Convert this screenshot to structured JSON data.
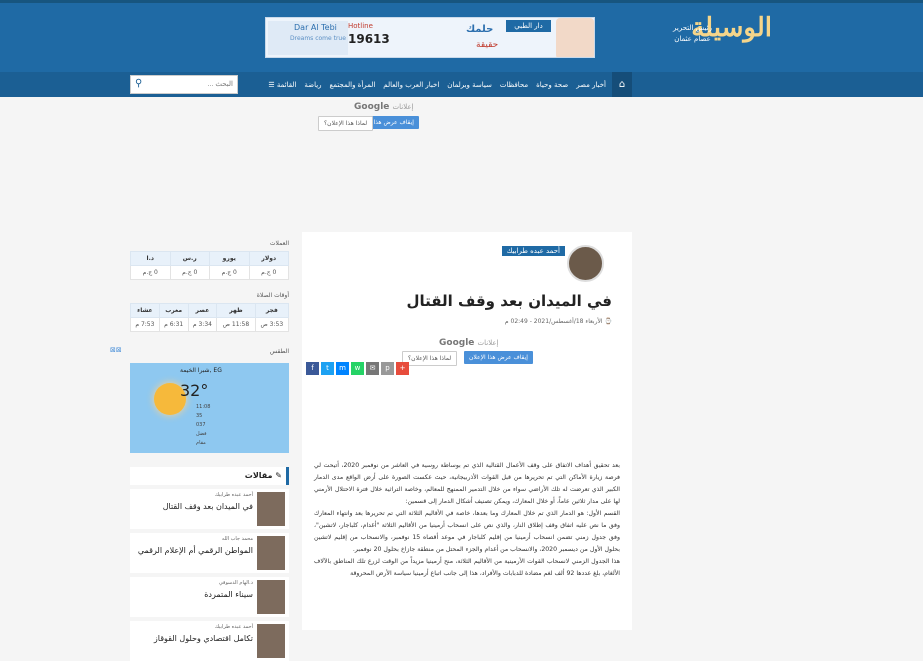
{
  "header": {
    "brand": "الوسيلة",
    "editor_label": "رئيس التحرير",
    "editor_name": "عصام عثمان",
    "banner": {
      "company": "Dar Al Tebi",
      "slogan": "Dreams come true",
      "hotline_label": "Hotline",
      "hotline": "19613",
      "ar_title": "حلمك",
      "ar_badge": "دار الطبي",
      "ar_sub": "حقيقة"
    }
  },
  "nav": {
    "home_icon": "home-icon",
    "items": [
      "أخبار مصر",
      "صحة وحياة",
      "محافظات",
      "سياسة وبرلمان",
      "اخبار العرب والعالم",
      "المرأة والمجتمع",
      "رياضة",
      "القائمة ☰"
    ],
    "search_placeholder": "البحث ..."
  },
  "ads": {
    "label": "إعلانات",
    "google": "Google",
    "stop": "إيقاف عرض هذا الإعلان",
    "why": "لماذا هذا الإعلان؟"
  },
  "article": {
    "author": "أحمد عبده طرابيك",
    "title": "في الميدان بعد وقف القتال",
    "meta": "الأربعاء 18/أغسطس/2021 - 02:49 م",
    "share": [
      {
        "icon": "facebook-icon",
        "glyph": "f",
        "color": "#3b5998"
      },
      {
        "icon": "twitter-icon",
        "glyph": "t",
        "color": "#1da1f2"
      },
      {
        "icon": "messenger-icon",
        "glyph": "m",
        "color": "#0084ff"
      },
      {
        "icon": "whatsapp-icon",
        "glyph": "w",
        "color": "#25d366"
      },
      {
        "icon": "email-icon",
        "glyph": "✉",
        "color": "#777"
      },
      {
        "icon": "print-icon",
        "glyph": "p",
        "color": "#999"
      },
      {
        "icon": "plus-icon",
        "glyph": "+",
        "color": "#e74c3c"
      }
    ],
    "paragraphs": [
      "بعد تحقيق أهداف الاتفاق على وقف الأعمال القتالية الذي تم بوساطة روسية في العاشر من نوفمبر 2020، أتيحت لي فرصة زيارة الأماكن التي تم تحريرها من قبل القوات الأذربيجانية، حيث عكست الصورة على أرض الواقع مدى الدمار الكبير الذي تعرضت له تلك الأراضي سواء من خلال التدمير الممنهج للمعالم، وخاصة التراثية خلال فترة الاحتلال الأرمني لها على مدار ثلاثين عاماً، أو خلال المعارك، ويمكن تصنيف أشكال الدمار إلى قسمين:",
      "القسم الأول: هو الدمار الذي تم خلال المعارك وما بعدها، خاصة في الأقاليم الثلاثة التي تم تحريرها بعد وانتهاء المعارك وفق ما نص عليه اتفاق وقف إطلاق النار، والذي نص على انسحاب أرمينيا من الأقاليم الثلاثة \"أغدام، كلباجار، لاتشين\"، وفق جدول زمني تضمن انسحاب أرمينيا من إقليم كلباجار في موعد أقصاه 15 نوفمبر، والانسحاب من إقليم لاتشين بحلول الأول من ديسمبر 2020، والانسحاب من أغدام والجزء المحتل من منطقة جازاخ بحلول 20 نوفمبر.",
      "هذا الجدول الزمني لانسحاب القوات الأرمينية من الأقاليم الثلاثة، منح أرمينيا مزيداً من الوقت لزرع تلك المناطق بالآلاف الألغام، بلغ عددها 92 ألف لغم مضادة للدبابات والأفراد، هذا إلى جانب اتباع أرمينيا سياسة الأرض المحروقة"
    ]
  },
  "sidebar": {
    "currency": {
      "title": "العملات",
      "headers": [
        "دولار",
        "يورو",
        "ر.س",
        "د.ا"
      ],
      "values": [
        "0 ج.م",
        "0 ج.م",
        "0 ج.م",
        "0 ج.م"
      ]
    },
    "prayer": {
      "title": "أوقات الصلاة",
      "headers": [
        "فجر",
        "ظهر",
        "عصر",
        "مغرب",
        "عشاء"
      ],
      "values": [
        "3:53 ص",
        "11:58 ص",
        "3:34 م",
        "6:31 م",
        "7:53 م"
      ]
    },
    "weather": {
      "title": "الطقس",
      "location": "EG ,شبرا الخيمة",
      "temp": "32°",
      "details": [
        "11:08",
        "35",
        "037",
        "فضل",
        "مقام"
      ]
    },
    "articles": {
      "title": "مقالات",
      "items": [
        {
          "author": "أحمد عبده طرابيك",
          "title": "في الميدان بعد وقف القتال"
        },
        {
          "author": "محمد جاب الله",
          "title": "المواطن الرقمي أم الإعلام الرقمي"
        },
        {
          "author": "د.الهام الدسوقي",
          "title": "سيناء المتمردة"
        },
        {
          "author": "أحمد عبده طرابيك",
          "title": "تكامل اقتصادي وحلول القوقاز"
        }
      ]
    }
  },
  "colors": {
    "primary": "#1f6aa5",
    "nav": "#1b5f94",
    "accent": "#f5d58a"
  }
}
